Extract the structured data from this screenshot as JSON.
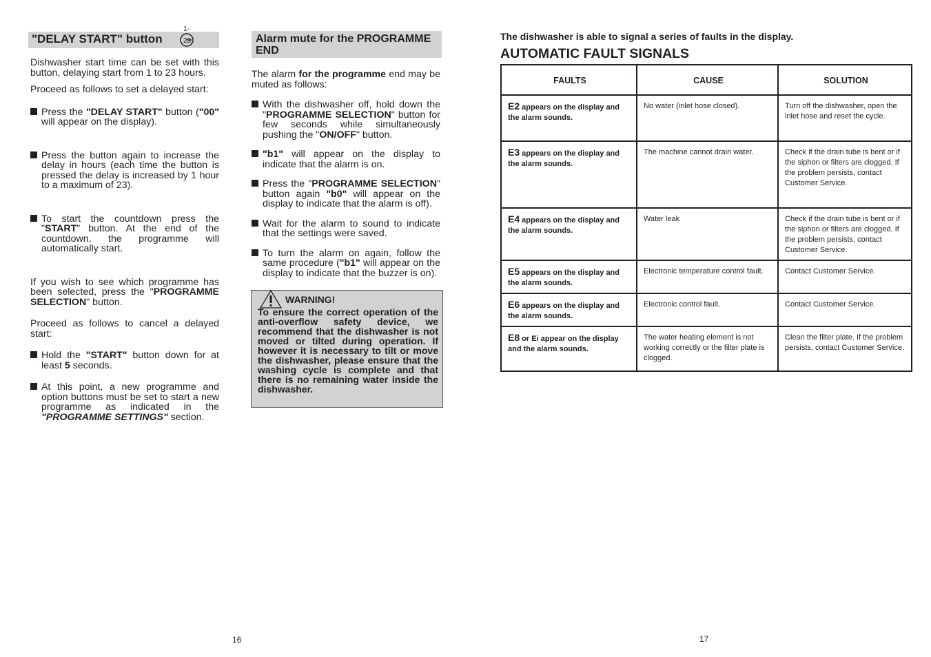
{
  "left": {
    "heading": "\"DELAY START\" button",
    "icon_label": "1-23",
    "paras": [
      {
        "bullet": false,
        "segs": [
          [
            "Dishwasher start time can be set with this button, delaying start from 1 to 23 hours.",
            ""
          ]
        ]
      },
      {
        "bullet": false,
        "segs": [
          [
            "Proceed as follows to set a delayed start:",
            ""
          ]
        ]
      },
      {
        "bullet": true,
        "segs": [
          [
            "Press the ",
            ""
          ],
          [
            "\"DELAY START\"",
            "b"
          ],
          [
            " button (",
            ""
          ],
          [
            "\"00\"",
            "b"
          ],
          [
            " will appear on the display).",
            ""
          ]
        ]
      },
      {
        "bullet": true,
        "segs": [
          [
            "Press the button again to increase the delay in hours (each time the button is pressed the delay is increased by 1 hour to a maximum of 23).",
            ""
          ]
        ]
      },
      {
        "bullet": true,
        "segs": [
          [
            "To start the countdown press the \"",
            ""
          ],
          [
            "START",
            "b"
          ],
          [
            "\" button. At the end of the countdown, the programme will automatically start.",
            ""
          ]
        ]
      },
      {
        "bullet": false,
        "segs": [
          [
            "If you wish to see which programme has been selected, press the \"",
            ""
          ],
          [
            "PROGRAMME SELECTION",
            "b"
          ],
          [
            "\" button.",
            ""
          ]
        ]
      },
      {
        "bullet": false,
        "segs": [
          [
            "Proceed as follows to cancel a delayed start:",
            ""
          ]
        ]
      },
      {
        "bullet": true,
        "segs": [
          [
            "Hold the ",
            ""
          ],
          [
            "\"START\"",
            "b"
          ],
          [
            " button down for at least ",
            ""
          ],
          [
            "5",
            "b"
          ],
          [
            " seconds.",
            ""
          ]
        ]
      },
      {
        "bullet": true,
        "segs": [
          [
            "At this point, a new programme and option buttons must be set to start a new programme as indicated in the ",
            ""
          ],
          [
            "\"PROGRAMME SETTINGS\"",
            "bi"
          ],
          [
            " section.",
            ""
          ]
        ]
      }
    ],
    "page_number": "16"
  },
  "middle": {
    "heading": "Alarm mute for the PROGRAMME END",
    "paras": [
      {
        "bullet": false,
        "segs": [
          [
            "The alarm ",
            ""
          ],
          [
            "for the programme",
            "b"
          ],
          [
            " end may be muted as follows:",
            ""
          ]
        ]
      },
      {
        "bullet": true,
        "segs": [
          [
            "With the dishwasher off, hold down the \"",
            ""
          ],
          [
            "PROGRAMME SELECTION",
            "b"
          ],
          [
            "\" button for few seconds while simultaneously pushing the \"",
            ""
          ],
          [
            "ON/OFF",
            "b"
          ],
          [
            "\" button.",
            ""
          ]
        ]
      },
      {
        "bullet": true,
        "segs": [
          [
            "\"b1\"",
            "b"
          ],
          [
            " will appear on the display to indicate that the alarm is on.",
            ""
          ]
        ]
      },
      {
        "bullet": true,
        "segs": [
          [
            "Press the \"",
            ""
          ],
          [
            "PROGRAMME SELECTION",
            "b"
          ],
          [
            "\" button again ",
            ""
          ],
          [
            "\"b0\"",
            "b"
          ],
          [
            " will appear on the display to indicate that the alarm is off).",
            ""
          ]
        ]
      },
      {
        "bullet": true,
        "segs": [
          [
            "Wait for the alarm to sound to indicate that the settings were saved.",
            ""
          ]
        ]
      },
      {
        "bullet": true,
        "segs": [
          [
            "To turn the alarm on again, follow the same procedure (",
            ""
          ],
          [
            "\"b1\"",
            "b"
          ],
          [
            " will appear on the display to indicate that the buzzer is on).",
            ""
          ]
        ]
      }
    ],
    "warning_title": "WARNING!",
    "warning_text": "To ensure the correct operation of the anti-overflow safety device, we recommend that the dishwasher is not moved or tilted during operation. If however it is necessary to tilt or move the dishwasher, please ensure that the washing cycle is complete and that there is no remaining water inside the dishwasher."
  },
  "right": {
    "intro": "The dishwasher is able to signal a series of faults in the display.",
    "title": "AUTOMATIC FAULT SIGNALS",
    "columns": [
      "FAULTS",
      "CAUSE",
      "SOLUTION"
    ],
    "rows": [
      {
        "code": "E2",
        "fault": " appears on the display and the alarm sounds.",
        "cause": "No water (inlet hose closed).",
        "solution": "Turn off the dishwasher, open the inlet hose and reset the cycle."
      },
      {
        "code": "E3",
        "fault": " appears on the display and the alarm sounds.",
        "cause": "The machine cannot drain water.",
        "solution": "Check if the drain tube is bent or if the siphon or filters are clogged. If the problem persists, contact Customer Service."
      },
      {
        "code": "E4",
        "fault": " appears on the display and the alarm sounds.",
        "cause": "Water leak",
        "solution": "Check if the drain tube is bent or if the siphon or filters are clogged. If the problem persists, contact Customer Service."
      },
      {
        "code": "E5",
        "fault": " appears on the display and the alarm sounds.",
        "cause": "Electronic temperature control fault.",
        "solution": "Contact Customer Service."
      },
      {
        "code": "E6",
        "fault": " appears on the display and the alarm sounds.",
        "cause": "Electronic control fault.",
        "solution": "Contact Customer Service."
      },
      {
        "code": "E8",
        "fault": " or Ei appear on the display and the alarm sounds.",
        "cause": "The water heating element is not working correctly or the filter plate is clogged.",
        "solution": "Clean the filter plate. If the problem persists, contact Customer Service."
      }
    ],
    "page_number": "17"
  }
}
